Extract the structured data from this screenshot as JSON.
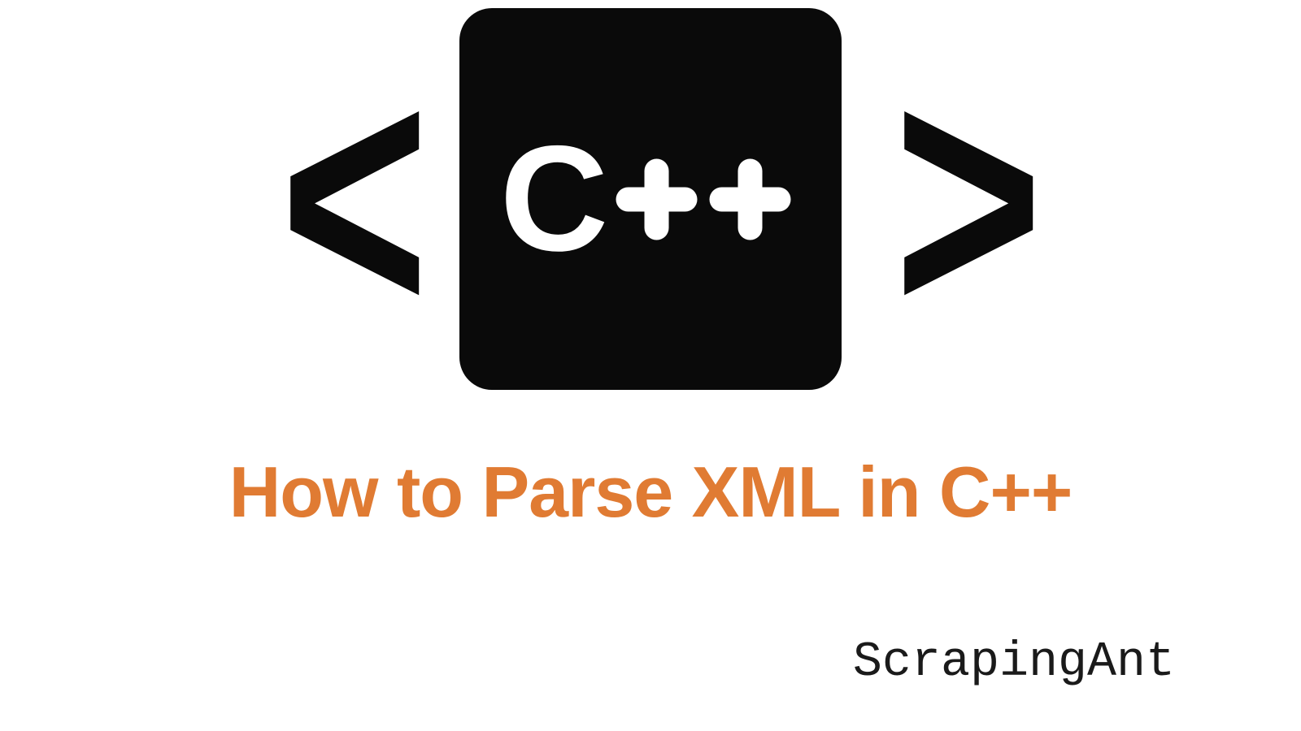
{
  "graphic": {
    "bracket_left": "<",
    "bracket_right": ">",
    "cpp_label_c": "C",
    "cpp_label_plus": "++"
  },
  "title": "How to Parse XML in C++",
  "brand": "ScrapingAnt",
  "colors": {
    "accent": "#e07b33",
    "dark": "#0a0a0a",
    "background": "#ffffff"
  }
}
